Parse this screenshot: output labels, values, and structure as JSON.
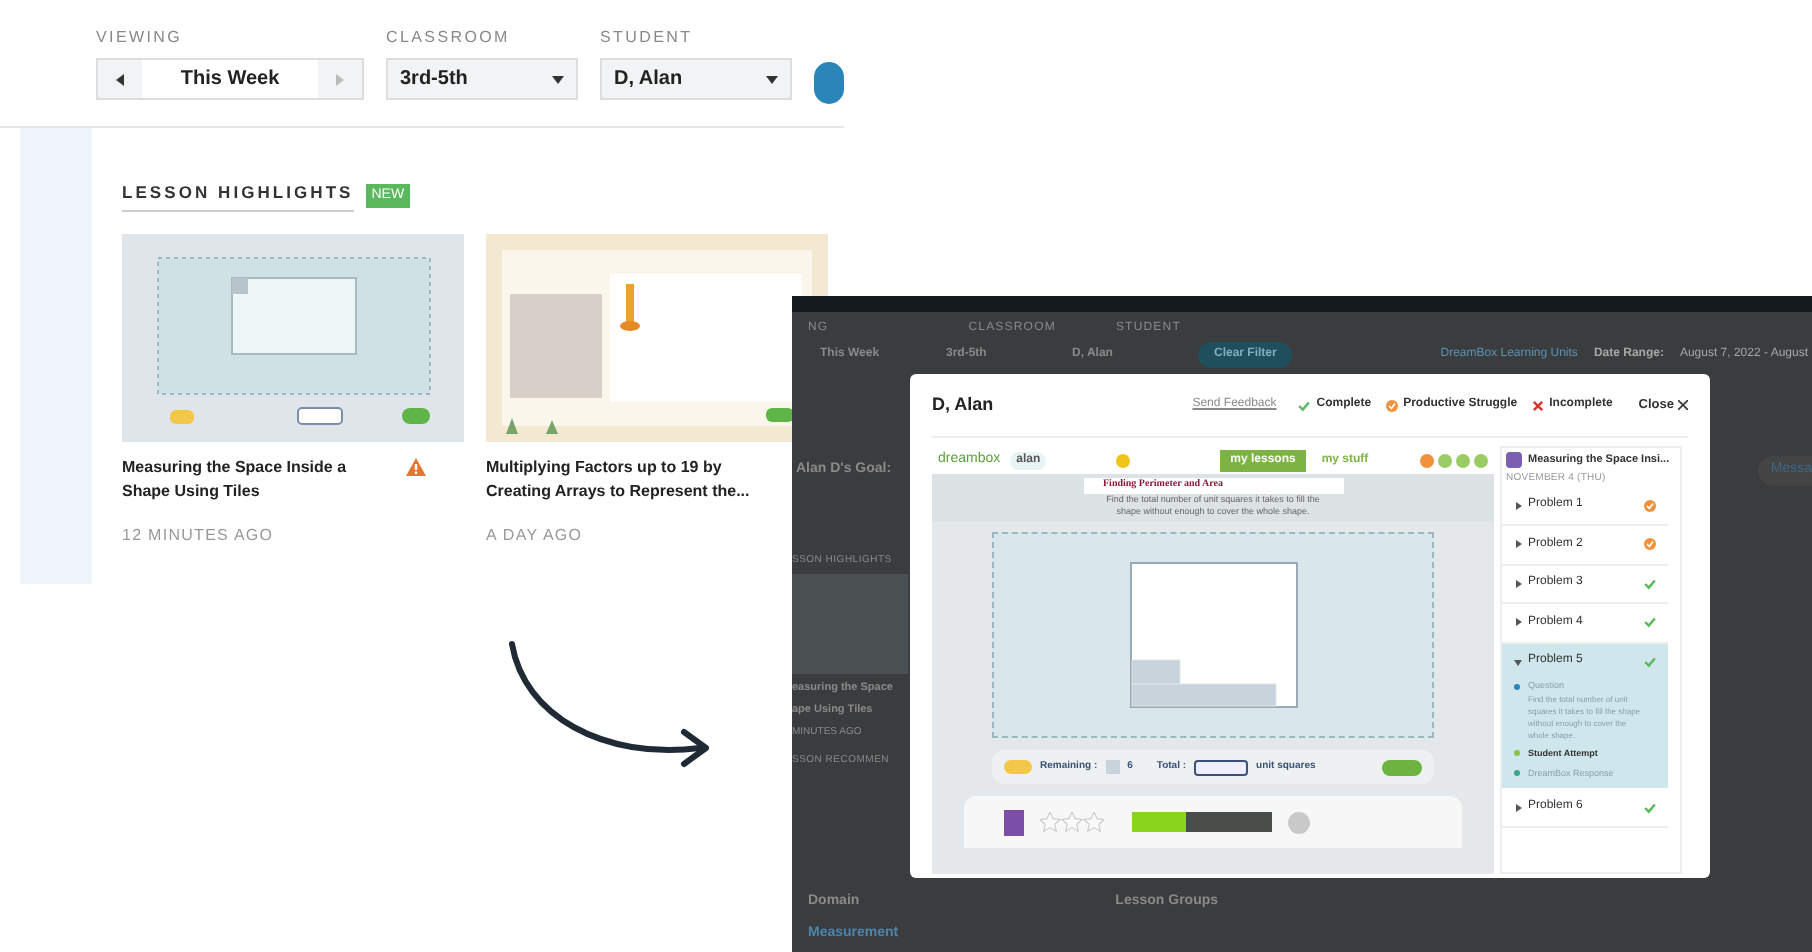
{
  "left_screen": {
    "filters": [
      {
        "label": "VIEWING",
        "kind": "week",
        "value": "This Week"
      },
      {
        "label": "CLASSROOM",
        "kind": "dropdown",
        "value": "3rd-5th"
      },
      {
        "label": "STUDENT",
        "kind": "dropdown",
        "value": "D, Alan"
      }
    ],
    "section_title": "LESSON HIGHLIGHTS",
    "badge": "NEW",
    "cards": [
      {
        "title": "Measuring the Space Inside a Shape Using Tiles",
        "time": "12 MINUTES AGO",
        "warning": true,
        "kind": "tiles"
      },
      {
        "title": "Multiplying Factors up to 19 by Creating Arrays to Represent the...",
        "time": "A DAY AGO",
        "warning": false,
        "kind": "arrays"
      }
    ]
  },
  "right_screen": {
    "background": {
      "filter_labels": [
        "NG",
        "CLASSROOM",
        "STUDENT"
      ],
      "filter_values": [
        "This Week",
        "3rd-5th",
        "D, Alan"
      ],
      "clear_button": "Clear Filter",
      "units_link": "DreamBox Learning Units",
      "date_label": "Date Range:",
      "date_value": "August 7, 2022 - August",
      "goal": "Alan D's Goal:",
      "message_button": "Messa",
      "highlights": "SSON HIGHLIGHTS",
      "card_title": "easuring the Space",
      "card_title_2": "ape Using Tiles",
      "card_time": "MINUTES AGO",
      "recommend": "SSON RECOMMEN",
      "domain": "Domain",
      "measurement": "Measurement",
      "groups": "Lesson Groups"
    },
    "modal": {
      "title": "D, Alan",
      "feedback_link": "Send Feedback",
      "legend": [
        {
          "kind": "complete",
          "label": "Complete"
        },
        {
          "kind": "struggle",
          "label": "Productive Struggle"
        },
        {
          "kind": "incomplete",
          "label": "Incomplete"
        }
      ],
      "close": "Close",
      "player": {
        "logo": "dreambox",
        "user": "alan",
        "tabs": [
          {
            "label": "my lessons",
            "selected": true
          },
          {
            "label": "my stuff",
            "selected": false
          }
        ],
        "heading": "Finding Perimeter and Area",
        "instruction": "Find the total number of unit squares it takes to fill the shape without enough to cover the whole shape.",
        "remaining_label": "Remaining :",
        "remaining": "6",
        "total_label": "Total :",
        "unit_label": "unit squares",
        "stars": 0,
        "level": 0.38
      },
      "sidebar": {
        "title": "Measuring the Space Insi...",
        "date": "NOVEMBER 4 (THU)",
        "problems": [
          {
            "label": "Problem 1",
            "kind": "struggle",
            "expanded": false
          },
          {
            "label": "Problem 2",
            "kind": "struggle",
            "expanded": false
          },
          {
            "label": "Problem 3",
            "kind": "complete",
            "expanded": false
          },
          {
            "label": "Problem 4",
            "kind": "complete",
            "expanded": false
          },
          {
            "label": "Problem 5",
            "kind": "complete",
            "expanded": true,
            "children": [
              {
                "kind": "question",
                "label": "Question",
                "text": "Find the total number of unit squares it takes to fill the shape without enough to cover the whole shape."
              },
              {
                "kind": "attempt",
                "label": "Student Attempt"
              },
              {
                "kind": "response",
                "label": "DreamBox Response"
              }
            ]
          },
          {
            "label": "Problem 6",
            "kind": "complete",
            "expanded": false
          }
        ]
      }
    }
  }
}
